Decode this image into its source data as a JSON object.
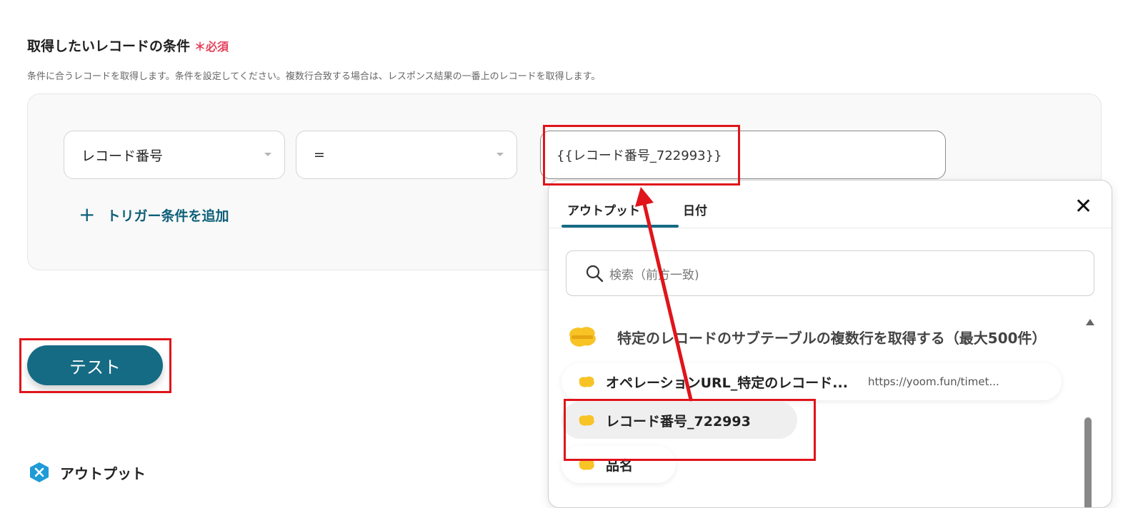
{
  "section": {
    "title": "取得したいレコードの条件",
    "required": "＊必須",
    "description": "条件に合うレコードを取得します。条件を設定してください。複数行合致する場合は、レスポンス結果の一番上のレコードを取得します。"
  },
  "condition": {
    "field_select": "レコード番号",
    "operator_select": "=",
    "value": "{{レコード番号_722993}}",
    "add_label": "トリガー条件を追加",
    "add_icon": "plus-icon"
  },
  "test_button": "テスト",
  "output_section": {
    "label": "アウトプット",
    "icon": "output-hex-icon"
  },
  "popup": {
    "tabs": [
      "アウトプット",
      "日付"
    ],
    "active_tab": "アウトプット",
    "close_icon": "close-icon",
    "search_placeholder": "検索（前方一致)",
    "group": {
      "app_logo": "kintone",
      "title": "特定のレコードのサブテーブルの複数行を取得する（最大500件）",
      "items": [
        {
          "label": "オペレーションURL_特定のレコード...",
          "value": "https://yoom.fun/timet..."
        },
        {
          "label": "レコード番号_722993"
        },
        {
          "label": "品名"
        }
      ]
    }
  },
  "colors": {
    "accent": "#156b84",
    "required": "#e5435a",
    "highlight": "#e0141b",
    "kintone": "#f7c325"
  }
}
